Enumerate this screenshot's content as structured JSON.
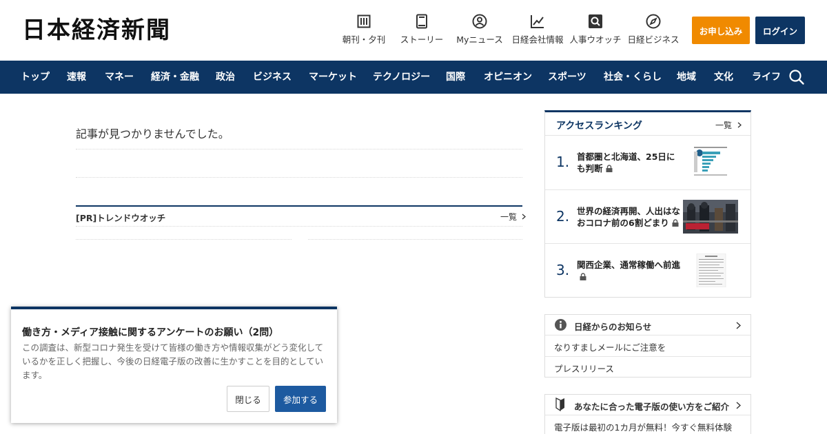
{
  "header": {
    "logo": "日本経済新聞",
    "tools": [
      {
        "icon": "newspaper-icon",
        "label": "朝刊・夕刊"
      },
      {
        "icon": "book-icon",
        "label": "ストーリー"
      },
      {
        "icon": "user-circle-icon",
        "label": "Myニュース"
      },
      {
        "icon": "chart-line-icon",
        "label": "日経会社情報"
      },
      {
        "icon": "magnifier-square-icon",
        "label": "人事ウオッチ"
      },
      {
        "icon": "compass-icon",
        "label": "日経ビジネス"
      }
    ],
    "apply_label": "お申し込み",
    "login_label": "ログイン",
    "apply_color": "#f08a00",
    "brand_color": "#0d3563"
  },
  "nav": {
    "items": [
      "トップ",
      "速報",
      "マネー",
      "経済・金融",
      "政治",
      "ビジネス",
      "マーケット",
      "テクノロジー",
      "国際",
      "オピニオン",
      "スポーツ",
      "社会・くらし",
      "地域",
      "文化",
      "ライフ"
    ],
    "search_icon": "search-icon"
  },
  "main": {
    "not_found": "記事が見つかりませんでした。",
    "pr_title": "[PR]トレンドウオッチ",
    "pr_more": "一覧"
  },
  "ranking": {
    "title": "アクセスランキング",
    "more": "一覧",
    "items": [
      {
        "rank": "1.",
        "title": "首都圏と北海道、25日にも判断"
      },
      {
        "rank": "2.",
        "title": "世界の経済再開、人出はなおコロナ前の6割どまり"
      },
      {
        "rank": "3.",
        "title": "関西企業、通常稼働へ前進"
      }
    ]
  },
  "info": {
    "title": "日経からのお知らせ",
    "items": [
      "なりすましメールにご注意を",
      "プレスリリース"
    ]
  },
  "guide": {
    "title": "あなたに合った電子版の使い方をご紹介",
    "text": "電子版は最初の1カ月が無料！今すぐ無料体験"
  },
  "survey": {
    "title": "働き方・メディア接触に関するアンケートのお願い（2問）",
    "body": "この調査は、新型コロナ発生を受けて皆様の働き方や情報収集がどう変化しているかを正しく把握し、今後の日経電子版の改善に生かすことを目的としています。",
    "close_label": "閉じる",
    "join_label": "参加する"
  }
}
